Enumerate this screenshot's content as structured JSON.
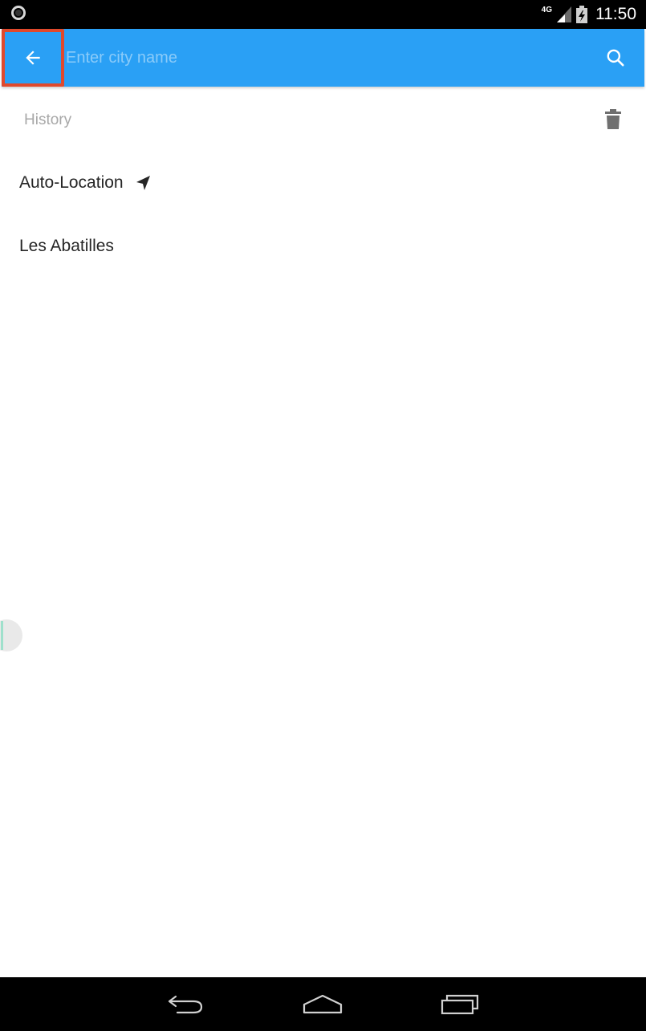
{
  "status_bar": {
    "network": "4G",
    "time": "11:50"
  },
  "toolbar": {
    "search_placeholder": "Enter city name",
    "search_value": "",
    "back_icon": "arrow-left-icon",
    "search_icon": "search-icon"
  },
  "history": {
    "header": "History",
    "delete_icon": "trash-icon",
    "items": [
      {
        "label": "Auto-Location",
        "icon": "navigation-arrow-icon"
      },
      {
        "label": "Les Abatilles"
      }
    ]
  },
  "navigation_bar": {
    "icons": [
      "back-icon",
      "home-icon",
      "recents-icon"
    ]
  },
  "colors": {
    "toolbar": "#2aa0f5",
    "highlight": "#e0492c",
    "text_primary": "#262626",
    "text_secondary": "#a8a8a8"
  }
}
